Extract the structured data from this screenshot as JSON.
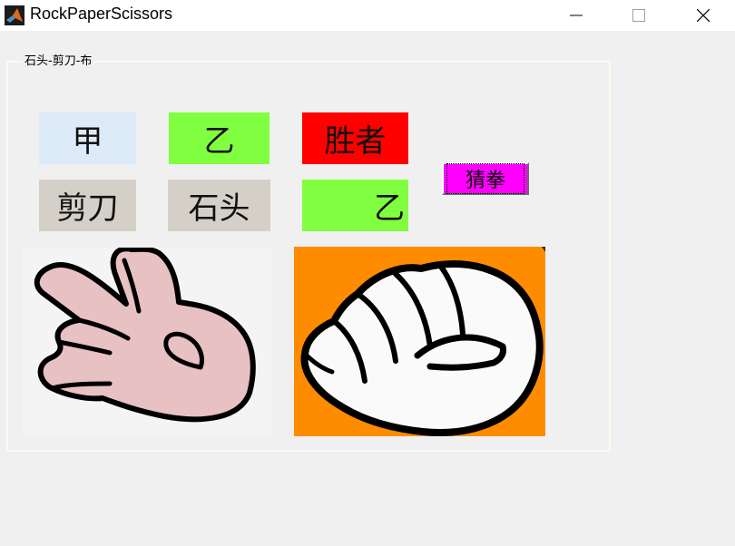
{
  "window": {
    "title": "RockPaperScissors",
    "icon": "matlab-icon",
    "controls": [
      "minimize-icon",
      "maximize-icon",
      "close-icon"
    ]
  },
  "panel": {
    "title": "石头-剪刀-布"
  },
  "players": {
    "a_label": "甲",
    "b_label": "乙",
    "winner_label": "胜者",
    "a_choice": "剪刀",
    "b_choice": "石头",
    "winner_value": "乙"
  },
  "guess_button": {
    "label": "猜拳"
  },
  "images": {
    "a_image": "scissors-hand",
    "b_image": "rock-fist"
  },
  "colors": {
    "a_label_bg": "#ddeaf8",
    "b_label_bg": "#80ff40",
    "winner_label_bg": "#ff0000",
    "choice_bg": "#d4d0c8",
    "winner_value_bg": "#80ff40",
    "button_bg": "#ff00ff",
    "b_image_bg": "#ff8c00"
  }
}
